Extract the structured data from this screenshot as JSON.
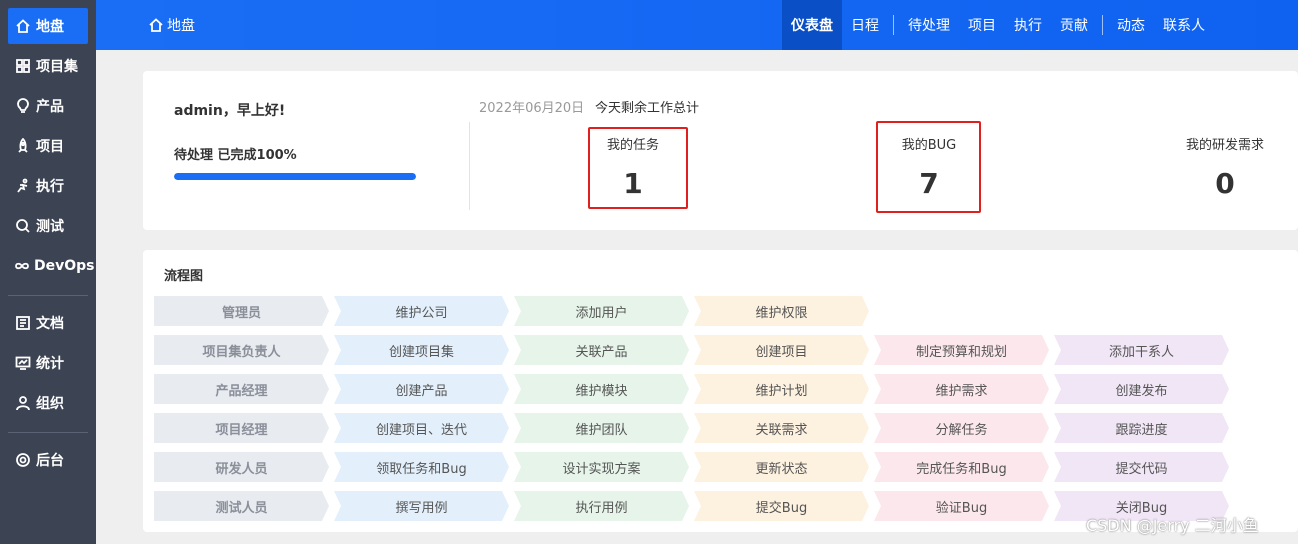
{
  "sidebar": {
    "items": [
      {
        "label": "地盘",
        "icon": "home-icon"
      },
      {
        "label": "项目集",
        "icon": "grid-icon"
      },
      {
        "label": "产品",
        "icon": "bulb-icon"
      },
      {
        "label": "项目",
        "icon": "rocket-icon"
      },
      {
        "label": "执行",
        "icon": "run-icon"
      },
      {
        "label": "测试",
        "icon": "search-test-icon"
      },
      {
        "label": "DevOps",
        "icon": "infinity-icon"
      },
      {
        "label": "文档",
        "icon": "doc-icon"
      },
      {
        "label": "统计",
        "icon": "monitor-icon"
      },
      {
        "label": "组织",
        "icon": "user-icon"
      },
      {
        "label": "后台",
        "icon": "gear-icon"
      }
    ]
  },
  "header": {
    "breadcrumb": "地盘",
    "nav": [
      "仪表盘",
      "日程",
      "待处理",
      "项目",
      "执行",
      "贡献",
      "动态",
      "联系人"
    ]
  },
  "summary": {
    "greeting": "admin，早上好!",
    "progress_label": "待处理 已完成100%",
    "progress_percent": 100,
    "date": "2022年06月20日",
    "work_total": "今天剩余工作总计",
    "stats": [
      {
        "label": "我的任务",
        "value": "1"
      },
      {
        "label": "我的BUG",
        "value": "7"
      },
      {
        "label": "我的研发需求",
        "value": "0"
      }
    ]
  },
  "flow": {
    "title": "流程图",
    "colors": [
      "#e8ebf0",
      "#e3f0fc",
      "#e6f4ea",
      "#fdf1e0",
      "#fce8ec",
      "#f1e6f6"
    ],
    "rows": [
      [
        "管理员",
        "维护公司",
        "添加用户",
        "维护权限"
      ],
      [
        "项目集负责人",
        "创建项目集",
        "关联产品",
        "创建项目",
        "制定预算和规划",
        "添加干系人"
      ],
      [
        "产品经理",
        "创建产品",
        "维护模块",
        "维护计划",
        "维护需求",
        "创建发布"
      ],
      [
        "项目经理",
        "创建项目、迭代",
        "维护团队",
        "关联需求",
        "分解任务",
        "跟踪进度"
      ],
      [
        "研发人员",
        "领取任务和Bug",
        "设计实现方案",
        "更新状态",
        "完成任务和Bug",
        "提交代码"
      ],
      [
        "测试人员",
        "撰写用例",
        "执行用例",
        "提交Bug",
        "验证Bug",
        "关闭Bug"
      ]
    ]
  },
  "watermark": "CSDN @Jerry 二河小鱼"
}
